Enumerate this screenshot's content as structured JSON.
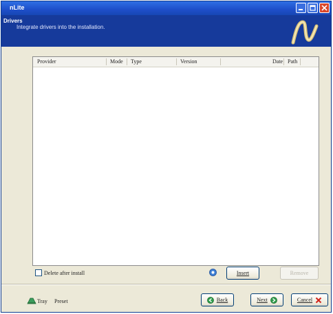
{
  "window": {
    "title": "nLite"
  },
  "header": {
    "title": "Drivers",
    "subtitle": "Integrate drivers into the installation."
  },
  "list": {
    "columns": [
      "Provider",
      "Mode",
      "Type",
      "Version",
      "Date",
      "Path"
    ],
    "rows": []
  },
  "options": {
    "delete_after_install": {
      "label": "Delete after install",
      "checked": false
    }
  },
  "actions": {
    "insert": "Insert",
    "remove": "Remove"
  },
  "footer": {
    "tray": "Tray",
    "preset": "Preset",
    "back": "Back",
    "next": "Next",
    "cancel": "Cancel"
  },
  "icons": {
    "minimize": "minimize-icon",
    "maximize": "maximize-icon",
    "close": "close-icon",
    "logo": "nlite-logo",
    "help": "help-icon",
    "back": "green-arrow-left-icon",
    "next": "green-arrow-right-icon",
    "cancel": "red-x-icon",
    "tray": "tray-icon"
  },
  "colors": {
    "header_bg": "#163a9b",
    "title_bar": "#1e4fc9",
    "window_bg": "#ece9d8"
  }
}
